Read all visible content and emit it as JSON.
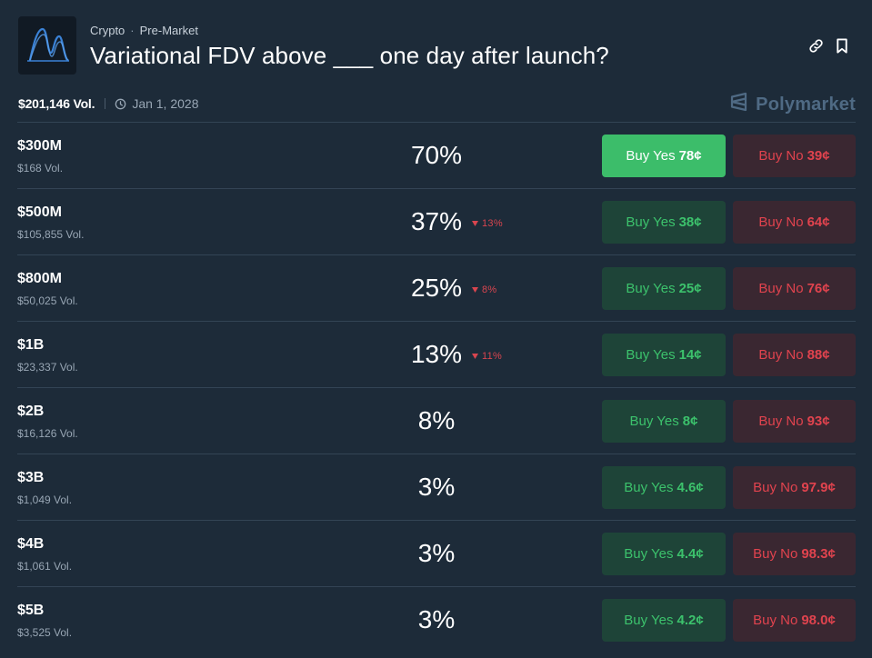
{
  "header": {
    "category": "Crypto",
    "subcategory": "Pre-Market",
    "title": "Variational FDV above ___ one day after launch?",
    "total_volume": "$201,146 Vol.",
    "end_date": "Jan 1, 2028",
    "brand": "Polymarket",
    "icons": [
      "market-logo-icon",
      "link-icon",
      "bookmark-icon",
      "clock-icon",
      "polymarket-logo-icon"
    ]
  },
  "colors": {
    "background": "#1d2b39",
    "yes_green": "#3cbd6a",
    "no_red": "#e0434e",
    "yes_bg": "#1e4438",
    "no_bg": "#3a2731"
  },
  "outcomes": [
    {
      "label": "$300M",
      "volume": "$168 Vol.",
      "probability": "70%",
      "change": "",
      "yes_label": "Buy Yes",
      "yes_price": "78¢",
      "no_label": "Buy No",
      "no_price": "39¢",
      "yes_active": true
    },
    {
      "label": "$500M",
      "volume": "$105,855 Vol.",
      "probability": "37%",
      "change": "13%",
      "yes_label": "Buy Yes",
      "yes_price": "38¢",
      "no_label": "Buy No",
      "no_price": "64¢",
      "yes_active": false
    },
    {
      "label": "$800M",
      "volume": "$50,025 Vol.",
      "probability": "25%",
      "change": "8%",
      "yes_label": "Buy Yes",
      "yes_price": "25¢",
      "no_label": "Buy No",
      "no_price": "76¢",
      "yes_active": false
    },
    {
      "label": "$1B",
      "volume": "$23,337 Vol.",
      "probability": "13%",
      "change": "11%",
      "yes_label": "Buy Yes",
      "yes_price": "14¢",
      "no_label": "Buy No",
      "no_price": "88¢",
      "yes_active": false
    },
    {
      "label": "$2B",
      "volume": "$16,126 Vol.",
      "probability": "8%",
      "change": "",
      "yes_label": "Buy Yes",
      "yes_price": "8¢",
      "no_label": "Buy No",
      "no_price": "93¢",
      "yes_active": false
    },
    {
      "label": "$3B",
      "volume": "$1,049 Vol.",
      "probability": "3%",
      "change": "",
      "yes_label": "Buy Yes",
      "yes_price": "4.6¢",
      "no_label": "Buy No",
      "no_price": "97.9¢",
      "yes_active": false
    },
    {
      "label": "$4B",
      "volume": "$1,061 Vol.",
      "probability": "3%",
      "change": "",
      "yes_label": "Buy Yes",
      "yes_price": "4.4¢",
      "no_label": "Buy No",
      "no_price": "98.3¢",
      "yes_active": false
    },
    {
      "label": "$5B",
      "volume": "$3,525 Vol.",
      "probability": "3%",
      "change": "",
      "yes_label": "Buy Yes",
      "yes_price": "4.2¢",
      "no_label": "Buy No",
      "no_price": "98.0¢",
      "yes_active": false
    }
  ]
}
